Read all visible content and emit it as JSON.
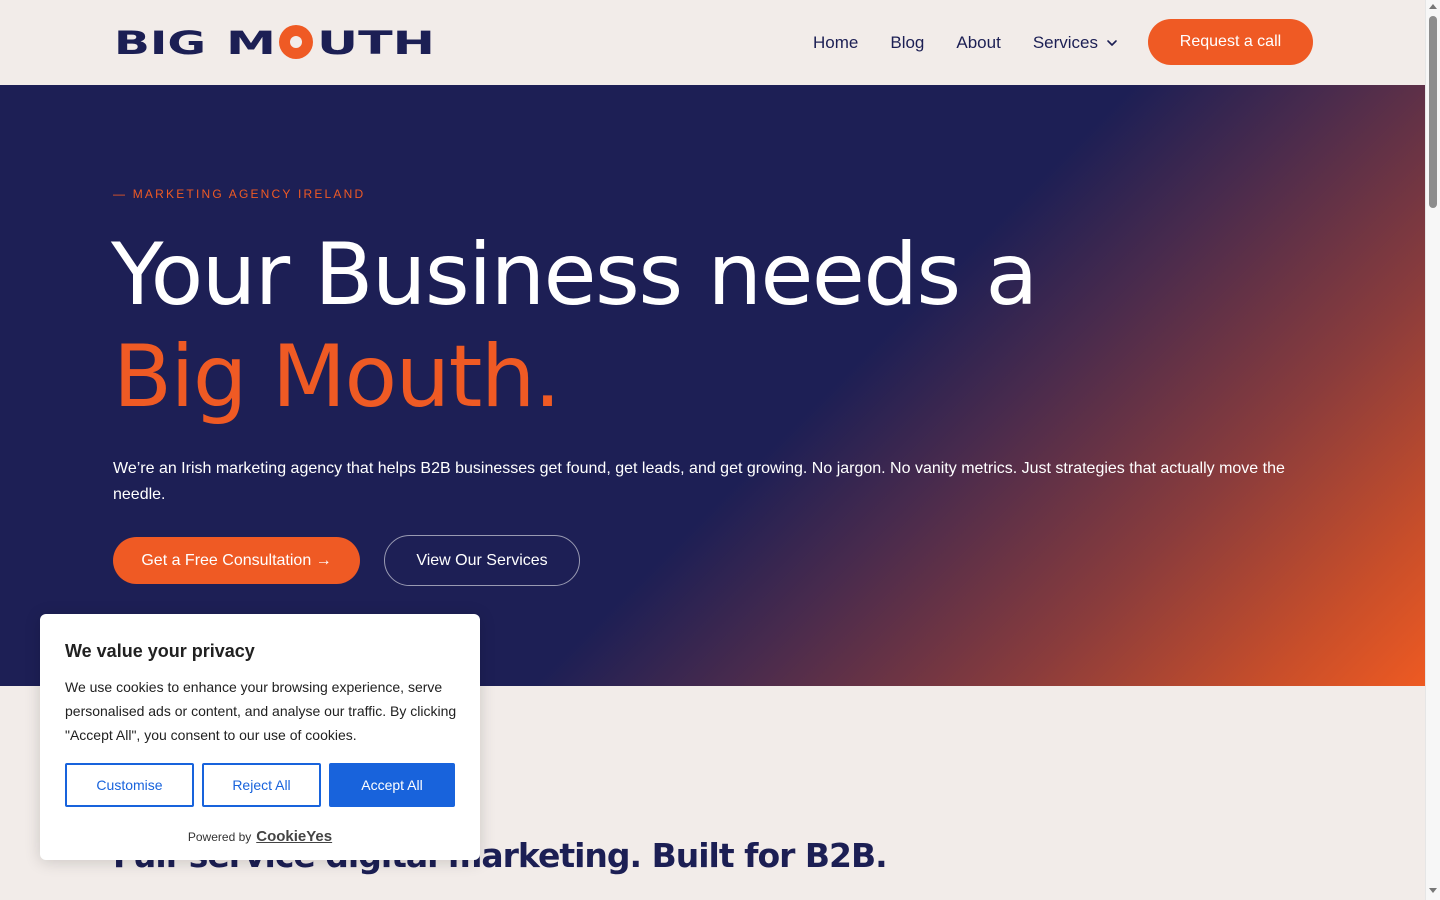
{
  "brand": {
    "logo_part1": "BIG M",
    "logo_part2": "UTH",
    "colors": {
      "navy": "#1c1f54",
      "orange": "#ef5a24",
      "cream": "#f2ece9"
    }
  },
  "nav": {
    "items": [
      {
        "label": "Home"
      },
      {
        "label": "Blog"
      },
      {
        "label": "About"
      },
      {
        "label": "Services",
        "icon": "chevron-down-icon"
      }
    ],
    "cta_label": "Request a call"
  },
  "hero": {
    "eyebrow": "— MARKETING AGENCY IRELAND",
    "headline_line1": "Your Business needs a",
    "headline_line2": "Big Mouth.",
    "lede": "We’re an Irish marketing agency that helps B2B businesses get found, get leads, and get growing. No jargon. No vanity metrics. Just strategies that actually move the needle.",
    "primary_button": "Get a Free Consultation →",
    "secondary_button": "View Our Services"
  },
  "services_section": {
    "title": "Full-service digital marketing. Built for B2B."
  },
  "cookie_banner": {
    "title": "We value your privacy",
    "text": "We use cookies to enhance your browsing experience, serve personalised ads or content, and analyse our traffic. By clicking \"Accept All\", you consent to our use of cookies.",
    "customise_label": "Customise",
    "reject_label": "Reject All",
    "accept_label": "Accept All",
    "powered_by_label": "Powered by",
    "powered_by_brand": "CookieYes",
    "accent_color": "#1863dc"
  }
}
